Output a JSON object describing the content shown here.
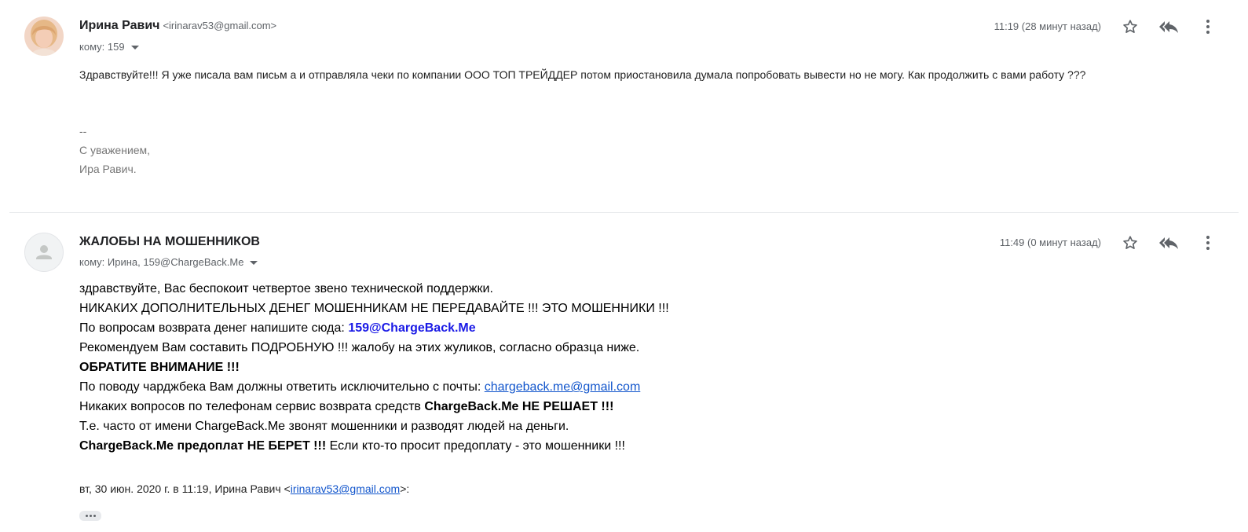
{
  "messages": [
    {
      "sender_name": "Ирина Равич",
      "sender_email": "<irinarav53@gmail.com>",
      "to_line": "кому: 159",
      "time": "11:19 (28 минут назад)",
      "body": "Здравствуйте!!! Я  уже писала  вам  письм а  и отправляла  чеки  по компании   ООО ТОП ТРЕЙДДЕР   потом  приостановила   думала попробовать вывести но  не могу. Как продолжить  с вами работу ???",
      "signature": [
        "--",
        "С уважением,",
        "Ира Равич."
      ]
    },
    {
      "sender_name": "ЖАЛОБЫ НА МОШЕННИКОВ",
      "to_line": "кому: Ирина, 159@ChargeBack.Me",
      "time": "11:49 (0 минут назад)",
      "lines": {
        "l1": "здравствуйте, Вас беспокоит четвертое звено технической поддержки.",
        "l2": "НИКАКИХ ДОПОЛНИТЕЛЬНЫХ ДЕНЕГ МОШЕННИКАМ НЕ ПЕРЕДАВАЙТЕ !!! ЭТО МОШЕННИКИ !!!",
        "l3_pre": "По вопросам возврата денег напишите сюда: ",
        "l3_email": "159@ChargeBack.Me",
        "l4": "Рекомендуем Вам составить ПОДРОБНУЮ !!! жалобу на этих жуликов, согласно образца ниже.",
        "l5": "ОБРАТИТЕ ВНИМАНИЕ !!!",
        "l6_pre": "По поводу чарджбека Вам должны ответить исключительно с почты: ",
        "l6_link": "chargeback.me@gmail.com",
        "l7_pre": "Никаких вопросов по телефонам сервис возврата средств ",
        "l7_bold": "ChargeBack.Me НЕ РЕШАЕТ !!!",
        "l8": "Т.е. часто от имени ChargeBack.Me звонят мошенники и разводят людей на деньги.",
        "l9_bold": "ChargeBack.Me предоплат НЕ БЕРЕТ !!!",
        "l9_post": " Если кто-то просит предоплату - это мошенники !!!"
      },
      "quote": {
        "pre": "вт, 30 июн. 2020 г. в 11:19, Ирина Равич <",
        "email": "irinarav53@gmail.com",
        "post": ">:"
      }
    }
  ],
  "icons": [
    "star-icon",
    "reply-all-icon",
    "more-vert-icon",
    "default-avatar-icon",
    "show-trimmed-content-icon"
  ],
  "colors": {
    "link": "#1155cc",
    "highlight_email": "#1a1ae6",
    "muted": "#5f6368",
    "signature": "#777777"
  }
}
